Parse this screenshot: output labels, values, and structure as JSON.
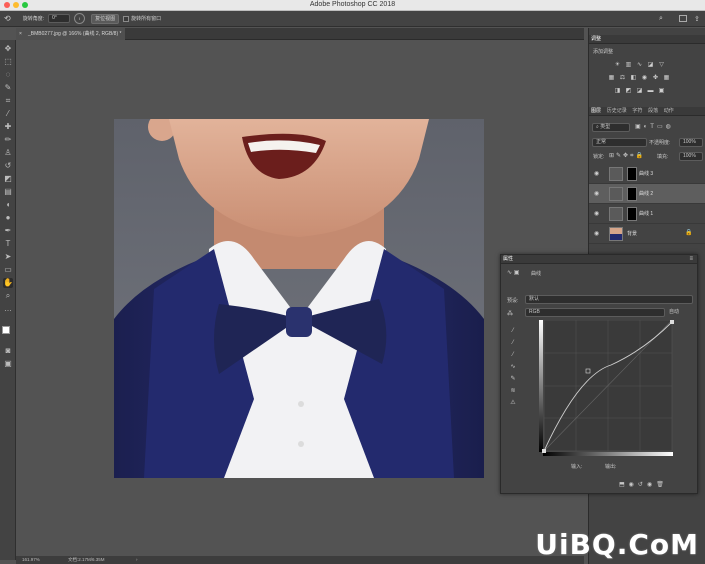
{
  "window": {
    "title": "Adobe Photoshop CC 2018"
  },
  "options": {
    "rotation_label": "旋转角度:",
    "rotation_value": "0°",
    "reset_view_label": "复位视图",
    "rotate_all_label": "旋转所有窗口"
  },
  "document": {
    "tab_label": "_BMB0277.jpg @ 166% (曲线 2, RGB/8) *",
    "zoom": "161.97%",
    "doc_size": "文档:2.17M/6.35M"
  },
  "adjustments": {
    "tab": "调整",
    "subtitle": "添加调整"
  },
  "layers": {
    "tabs": [
      "图层",
      "历史记录",
      "字符",
      "段落",
      "动作"
    ],
    "kind_filter": "类型",
    "blend_mode": "正常",
    "opacity_label": "不透明度:",
    "opacity_value": "100%",
    "lock_label": "锁定:",
    "fill_label": "填充:",
    "fill_value": "100%",
    "items": [
      {
        "name": "曲线 3"
      },
      {
        "name": "曲线 2"
      },
      {
        "name": "曲线 1"
      },
      {
        "name": "背景"
      }
    ]
  },
  "properties": {
    "tab": "属性",
    "type_label": "曲线",
    "preset_label": "预设:",
    "preset_value": "默认",
    "channel_value": "RGB",
    "auto_label": "自动",
    "input_label": "输入:",
    "output_label": "输出:"
  },
  "watermark": {
    "text": "UiBQ.CoM"
  }
}
